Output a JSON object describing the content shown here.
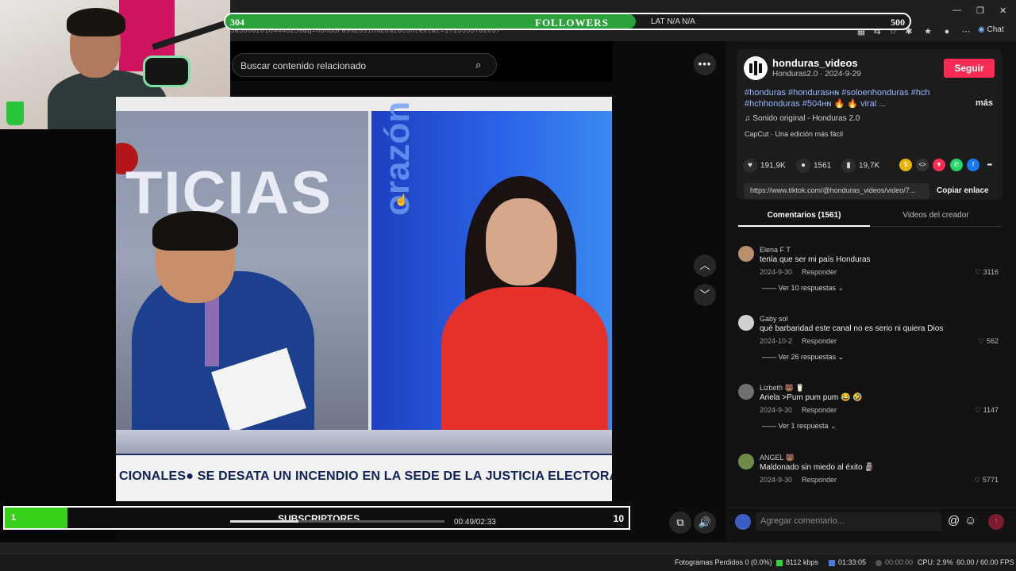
{
  "browser": {
    "url_fragment": "3a506028164448259&q=honduras%20sin%20%20context&t=1723553782637",
    "chat_label": "Chat"
  },
  "followers": {
    "start": "304",
    "label": "FOLLOWERS",
    "end": "500",
    "lat_label": "LAT N/A N/A",
    "progress": 0.6
  },
  "search": {
    "placeholder": "Buscar contenido relacionado"
  },
  "video": {
    "channel_text": "TICIAS",
    "side_text": "orazón",
    "ticker": "CIONALES● SE DESATA UN INCENDIO EN LA SEDE DE LA JUSTICIA ELECTORAL DE"
  },
  "post": {
    "username": "honduras_videos",
    "meta": "Honduras2.0 · 2024-9-29",
    "follow_label": "Seguir",
    "hashtags": "#honduras #hondurasʜɴ #soloenhonduras #hch #hchhonduras #504ʜɴ 🔥 🔥 viral ...",
    "more_label": "más",
    "sound": "♫  Sonido original - Honduras 2.0",
    "capcut": "CapCut · Una edición más fácil",
    "likes": "191,9K",
    "comments": "1561",
    "saves": "19,7K",
    "link": "https://www.tiktok.com/@honduras_videos/video/7...",
    "copy_label": "Copiar enlace"
  },
  "tabs": {
    "comments": "Comentarios (1561)",
    "creator": "Videos del creador"
  },
  "comments": [
    {
      "name": "Elena F T",
      "text": "tenía que ser mi país Honduras",
      "date": "2024-9-30",
      "reply": "Responder",
      "likes": "♡ 3116",
      "view": "—— Ver 10 respuestas ⌄"
    },
    {
      "name": "Gaby sol",
      "text": "qué barbaridad este canal no es serio ni quiera Dios",
      "date": "2024-10-2",
      "reply": "Responder",
      "likes": "♡ 562",
      "view": "—— Ver 26 respuestas ⌄"
    },
    {
      "name": "Lizbeth 🐻 🥛",
      "text": "Ariela >Pum pum pum 😂 🤣",
      "date": "2024-9-30",
      "reply": "Responder",
      "likes": "♡ 1147",
      "view": "—— Ver 1 respuesta ⌄"
    },
    {
      "name": "ANGEL 🐻",
      "text": "Maldonado sin miedo al éxito 🗿",
      "date": "2024-9-30",
      "reply": "Responder",
      "likes": "♡ 5771",
      "view": ""
    }
  ],
  "comment_input": {
    "placeholder": "Agregar comentario..."
  },
  "subscribers": {
    "start": "1",
    "label": "SUBSCRIPTORES",
    "end": "10",
    "progress": 0.1
  },
  "player": {
    "time": "00:49/02:33",
    "progress": 0.32
  },
  "status_bar": {
    "dropped_frames": "Fotogramas Perdidos 0 (0.0%)",
    "bitrate": "8112 kbps",
    "stream_time": "01:33:05",
    "record_time": "00:00:00",
    "cpu": "CPU: 2.9%",
    "fps": "60.00 / 60.00 FPS"
  },
  "colors": {
    "accent_pink": "#fe2c55",
    "followers_green": "#2aa33a",
    "subs_green": "#39d01a",
    "hashtag_blue": "#9bb6ff"
  },
  "icons": [
    "search-icon",
    "more-icon",
    "chevron-up-icon",
    "chevron-down-icon",
    "heart-icon",
    "comment-icon",
    "bookmark-icon",
    "music-icon",
    "at-icon",
    "emoji-icon",
    "send-icon",
    "volume-icon",
    "pip-icon"
  ]
}
